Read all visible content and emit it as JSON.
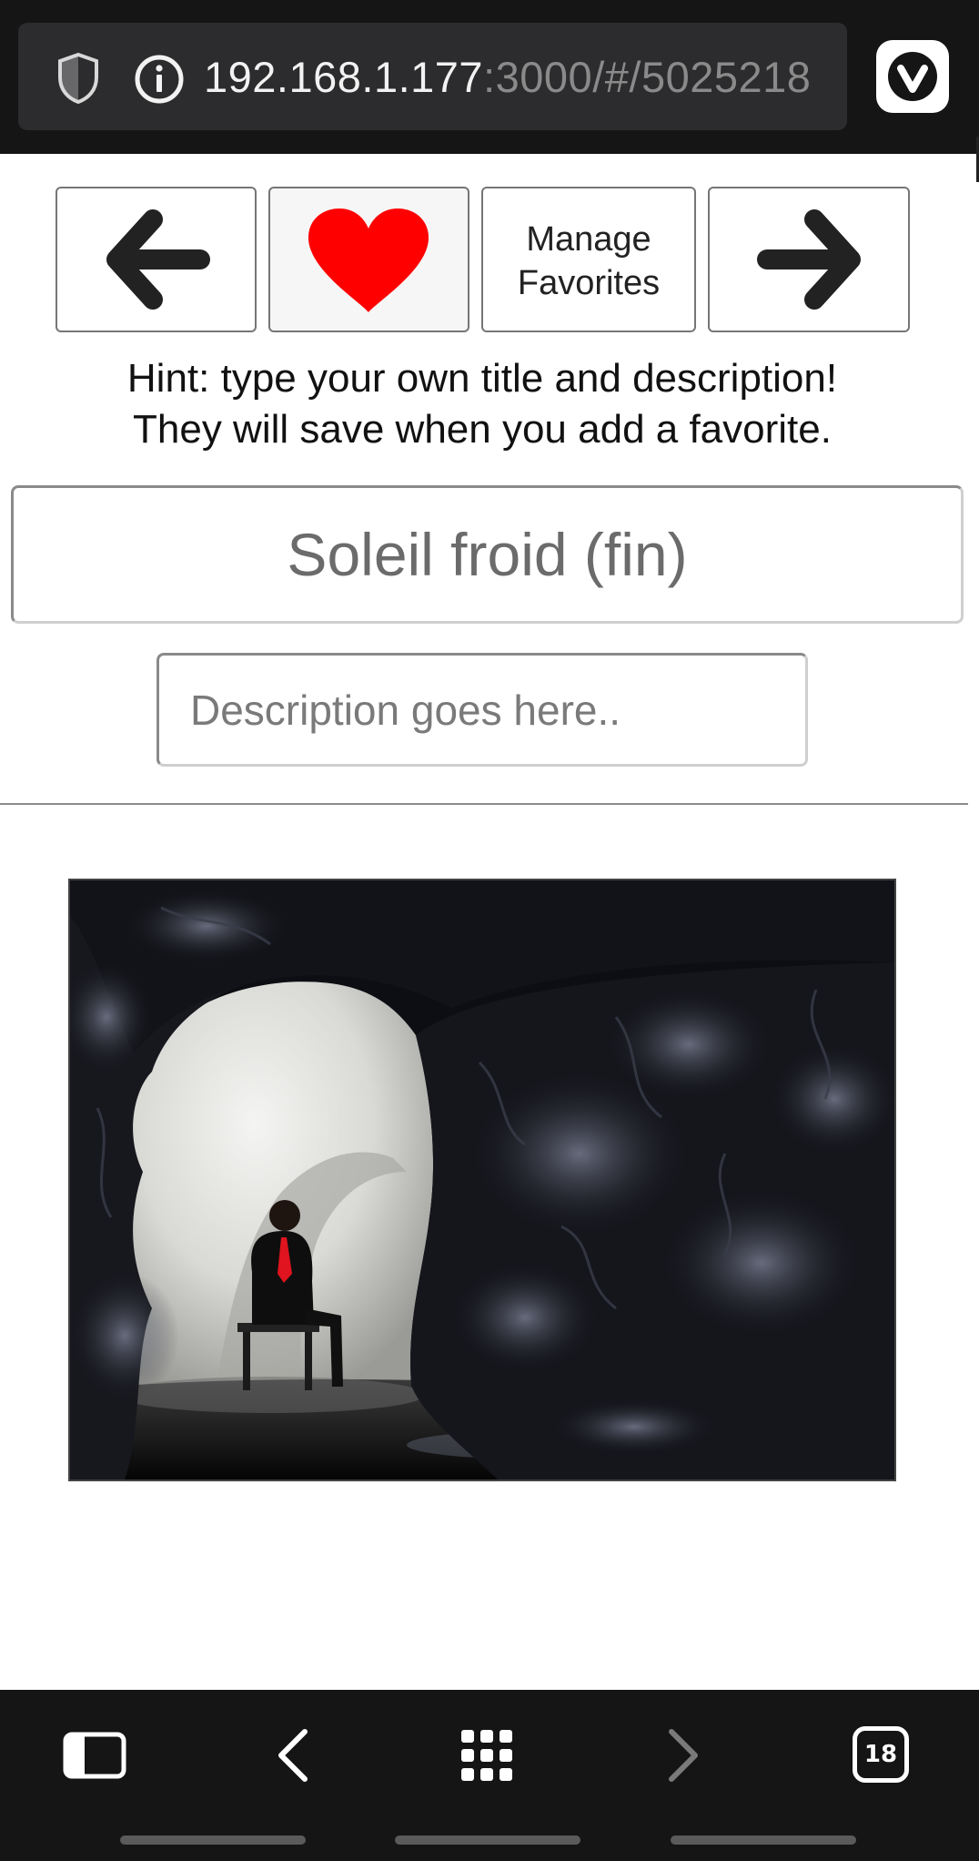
{
  "browser": {
    "url_host": "192.168.1.177",
    "url_path": ":3000/#/5025218",
    "tab_count": "18"
  },
  "controls": {
    "prev_icon": "arrow-left-icon",
    "favorite_icon": "heart-icon",
    "manage_line1": "Manage",
    "manage_line2": "Favorites",
    "next_icon": "arrow-right-icon"
  },
  "hint": {
    "line1": "Hint: type your own title and description!",
    "line2": "They will save when you add a favorite."
  },
  "title_field": {
    "placeholder": "Soleil froid (fin)"
  },
  "description_field": {
    "placeholder": "Description goes here.."
  },
  "colors": {
    "heart": "#ff0000",
    "bar_background": "#151515"
  },
  "bottom_bar": {
    "icons": [
      "panel-icon",
      "back-icon",
      "speed-dial-icon",
      "forward-icon",
      "tabs-icon"
    ]
  }
}
